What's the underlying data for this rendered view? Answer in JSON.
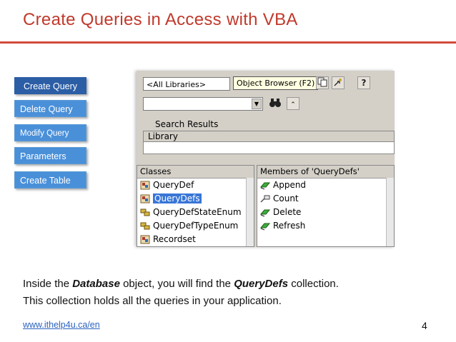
{
  "slide": {
    "title": "Create Queries in Access with VBA",
    "page_number": "4",
    "footer_link": "www.ithelp4u.ca/en"
  },
  "nav": {
    "items": [
      {
        "label": "Create Query",
        "active": true
      },
      {
        "label": "Delete Query",
        "active": false
      },
      {
        "label": "Modify Query",
        "active": false
      },
      {
        "label": "Parameters",
        "active": false
      },
      {
        "label": "Create Table",
        "active": false
      }
    ]
  },
  "object_browser": {
    "library_combo_value": "<All Libraries>",
    "tooltip": "Object Browser (F2)",
    "search_combo_value": "",
    "search_results_label": "Search Results",
    "results_column": "Library",
    "classes_header": "Classes",
    "classes": [
      {
        "label": "QueryDef",
        "icon": "class-icon"
      },
      {
        "label": "QueryDefs",
        "icon": "class-icon",
        "selected": true
      },
      {
        "label": "QueryDefStateEnum",
        "icon": "enum-icon"
      },
      {
        "label": "QueryDefTypeEnum",
        "icon": "enum-icon"
      },
      {
        "label": "Recordset",
        "icon": "class-icon"
      }
    ],
    "members_header": "Members of 'QueryDefs'",
    "members": [
      {
        "label": "Append",
        "icon": "method-icon"
      },
      {
        "label": "Count",
        "icon": "property-icon"
      },
      {
        "label": "Delete",
        "icon": "method-icon"
      },
      {
        "label": "Refresh",
        "icon": "method-icon"
      }
    ]
  },
  "description": {
    "line1_pre": "Inside the ",
    "line1_em1": "Database",
    "line1_mid": " object, you will find the ",
    "line1_em2": "QueryDefs",
    "line1_post": " collection.",
    "line2": "This collection holds all the queries in your application."
  },
  "colors": {
    "title": "#c0392b",
    "rule": "#d24a3a",
    "nav_active": "#2c5ea6",
    "nav_inactive": "#4a90d9",
    "link": "#2a62c0"
  }
}
